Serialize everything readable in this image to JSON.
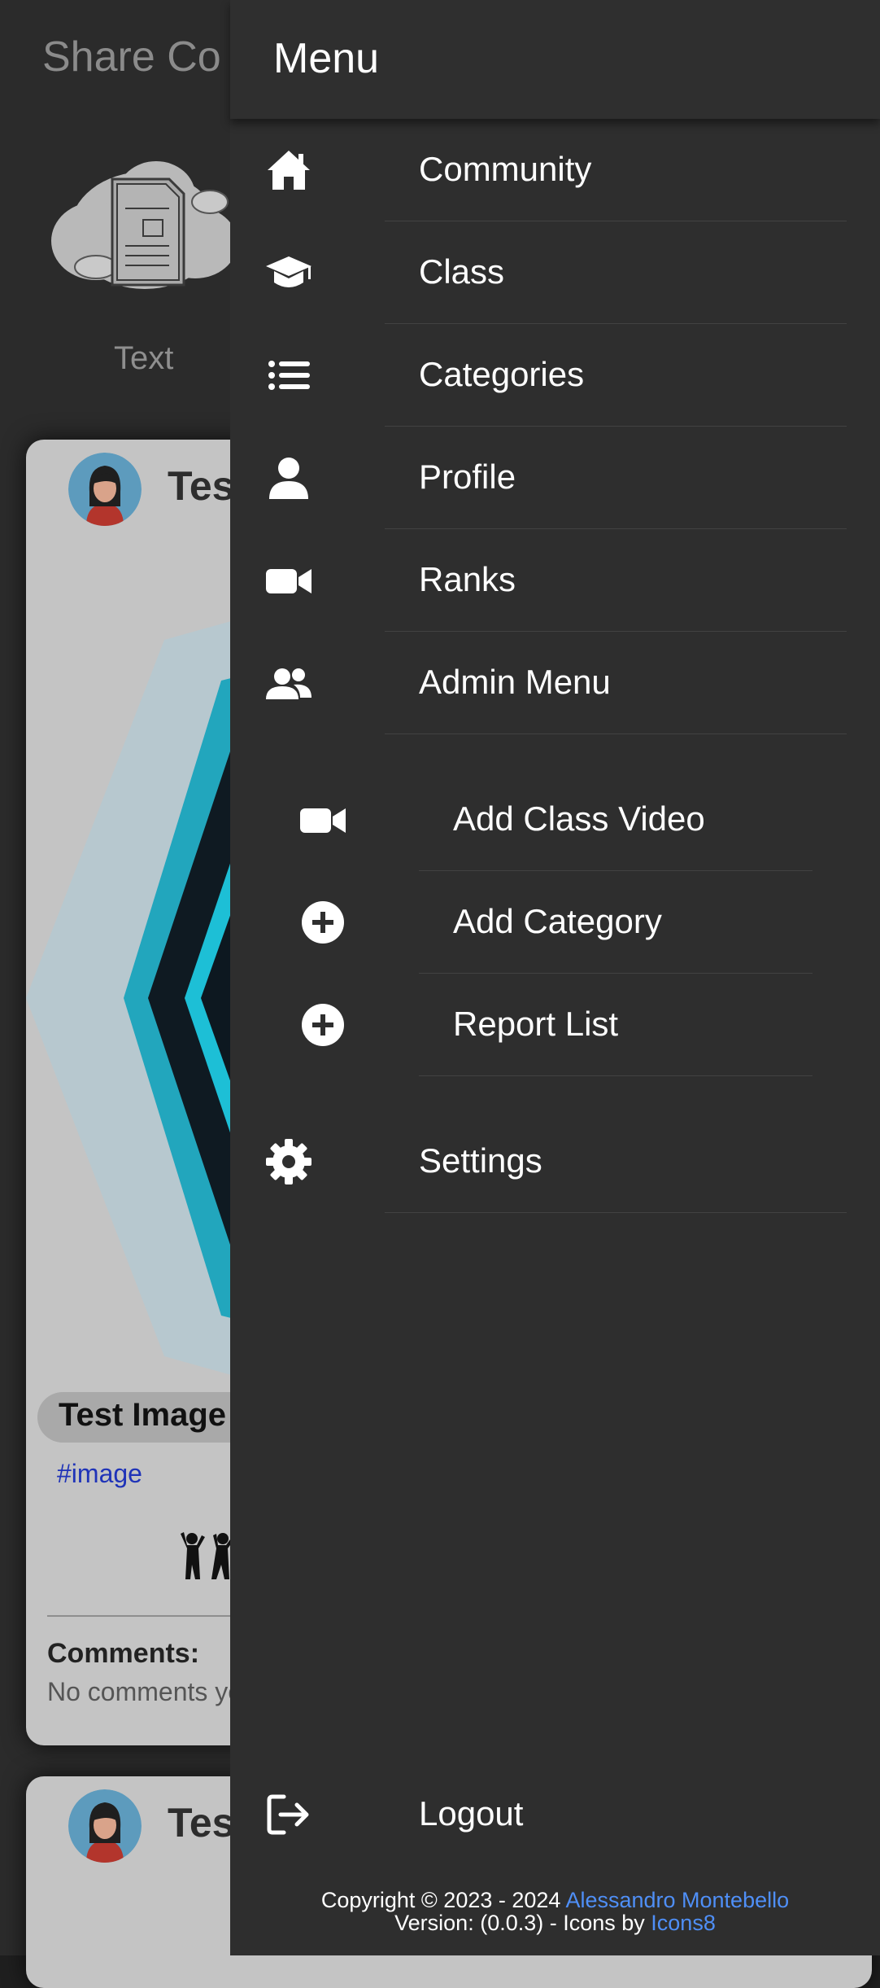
{
  "background": {
    "page_title": "Share Co",
    "text_option_label": "Text",
    "post1": {
      "author": "Tes",
      "title": "Test Image",
      "tag": "#image",
      "comments_title": "Comments:",
      "comments_empty": "No comments ye"
    },
    "post2": {
      "author": "Tes"
    }
  },
  "drawer": {
    "title": "Menu",
    "items": [
      {
        "label": "Community",
        "icon": "home-icon"
      },
      {
        "label": "Class",
        "icon": "graduation-cap-icon"
      },
      {
        "label": "Categories",
        "icon": "list-icon"
      },
      {
        "label": "Profile",
        "icon": "user-icon"
      },
      {
        "label": "Ranks",
        "icon": "video-icon"
      },
      {
        "label": "Admin Menu",
        "icon": "users-icon"
      }
    ],
    "admin_items": [
      {
        "label": "Add Class Video",
        "icon": "video-icon"
      },
      {
        "label": "Add Category",
        "icon": "plus-circle-icon"
      },
      {
        "label": "Report List",
        "icon": "plus-circle-icon"
      }
    ],
    "settings": {
      "label": "Settings",
      "icon": "gear-icon"
    },
    "logout": {
      "label": "Logout",
      "icon": "logout-icon"
    },
    "footer": {
      "copyright": "Copyright © 2023 - 2024 ",
      "author_link": "Alessandro Montebello",
      "version": "Version: (0.0.3) - Icons by ",
      "icons_link": "Icons8"
    }
  },
  "colors": {
    "drawer_bg": "#2e2e2e",
    "link": "#4f8ff7",
    "hashtag": "#1f33b8"
  }
}
